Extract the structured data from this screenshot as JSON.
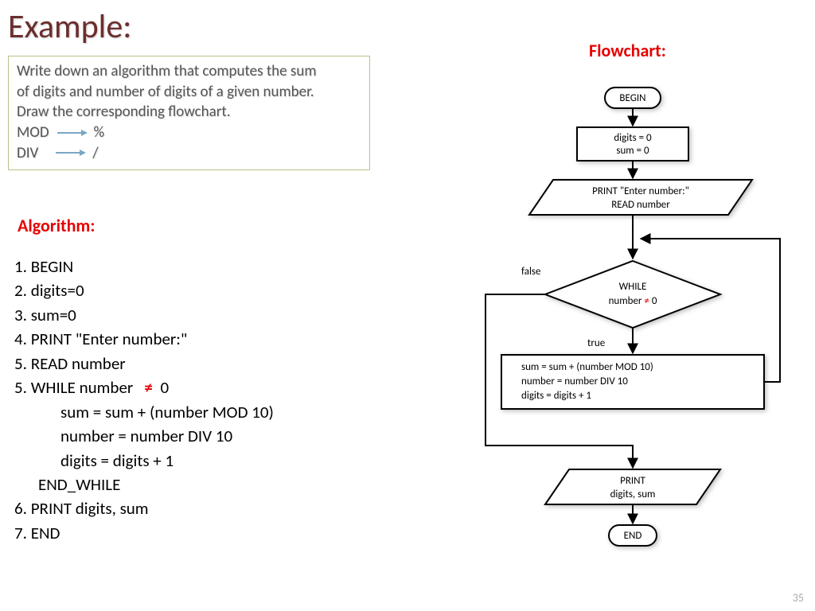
{
  "title": "Example:",
  "problem": {
    "line1": "Write down an algorithm that computes the sum",
    "line2": "of digits and number of digits of a given number.",
    "line3": "Draw the corresponding flowchart.",
    "mod_label": "MOD",
    "mod_sym": "%",
    "div_label": "DIV",
    "div_sym": "/"
  },
  "algorithm_title": "Algorithm:",
  "flowchart_title": "Flowchart:",
  "algo": {
    "l1": "1. BEGIN",
    "l2": "2. digits=0",
    "l3": "3. sum=0",
    "l4": "4. PRINT \"Enter number:\"",
    "l5": "5. READ number",
    "l6a": "5. WHILE number ",
    "l6b": " 0",
    "l7": "sum = sum + (number MOD 10)",
    "l8": "number = number DIV 10",
    "l9": "digits = digits + 1",
    "l10": "END_WHILE",
    "l11": "6.  PRINT digits, sum",
    "l12": "7.  END"
  },
  "neq": "≠",
  "flow": {
    "begin": "BEGIN",
    "init1": "digits = 0",
    "init2": "sum = 0",
    "io1": "PRINT \"Enter number:\"",
    "io2": "READ number",
    "dec1": "WHILE",
    "dec2a": "number ",
    "dec2b": " 0",
    "body1": "sum = sum + (number MOD 10)",
    "body2": "number = number DIV 10",
    "body3": "digits = digits + 1",
    "out1": "PRINT",
    "out2": "digits, sum",
    "end": "END",
    "false_lbl": "false",
    "true_lbl": "true"
  },
  "page_number": "35"
}
